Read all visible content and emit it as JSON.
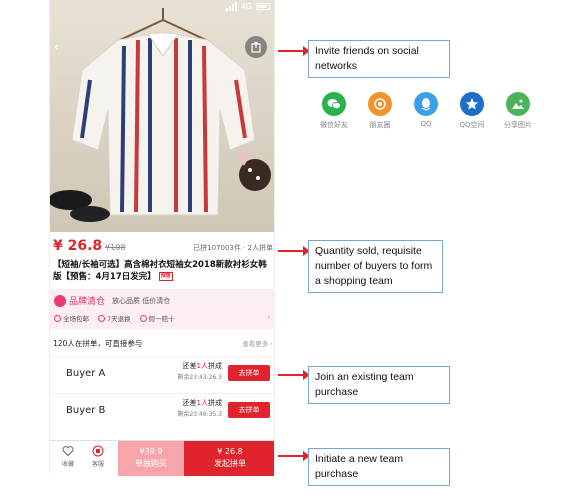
{
  "status_bar": {
    "network": "4G"
  },
  "product": {
    "price": "¥ 26.8",
    "original_price": "¥108",
    "sold_info": "已拼107003件 · 2人拼单",
    "title": "【短袖/长袖可选】高含棉衬衣短袖女2018新款衬衫女韩版【预售：4月17日发完】",
    "presale_badge": "预售"
  },
  "brand": {
    "name": "品牌清仓",
    "slogan": "放心品质 低价清仓",
    "guarantees": [
      "全场包邮",
      "7天退换",
      "假一赔十"
    ]
  },
  "teams": {
    "header": "120人在拼单，可直接参与",
    "more": "查看更多",
    "items": [
      {
        "name": "Buyer A",
        "need_prefix": "还差",
        "need_count": "1人",
        "need_suffix": "拼成",
        "remaining": "剩余23:43:26.3",
        "join_label": "去拼单"
      },
      {
        "name": "Buyer B",
        "need_prefix": "还差",
        "need_count": "1人",
        "need_suffix": "拼成",
        "remaining": "剩余23:46:35.3",
        "join_label": "去拼单"
      }
    ]
  },
  "bottom_bar": {
    "favorite": "收藏",
    "service": "客服",
    "buy_alone_price": "¥39.9",
    "buy_alone_label": "单独购买",
    "start_team_price": "¥ 26.8",
    "start_team_label": "发起拼单"
  },
  "share_targets": [
    {
      "label": "微信好友",
      "icon": "wechat-icon",
      "color": "#2bb24c"
    },
    {
      "label": "朋友圈",
      "icon": "moments-icon",
      "color": "#f3922f"
    },
    {
      "label": "QQ",
      "icon": "qq-icon",
      "color": "#3c9ee8"
    },
    {
      "label": "QQ空间",
      "icon": "qzone-icon",
      "color": "#1f6fc8"
    },
    {
      "label": "分享图片",
      "icon": "image-icon",
      "color": "#4bb35a"
    }
  ],
  "annotations": {
    "invite": "Invite friends on social networks",
    "quantity": "Quantity sold, requisite number of buyers to form a shopping team",
    "join": "Join an existing team purchase",
    "initiate": "Initiate a new team purchase"
  },
  "colors": {
    "accent": "#e0242d",
    "brand_pink": "#d8336f",
    "note_border": "#7aa6d6"
  }
}
